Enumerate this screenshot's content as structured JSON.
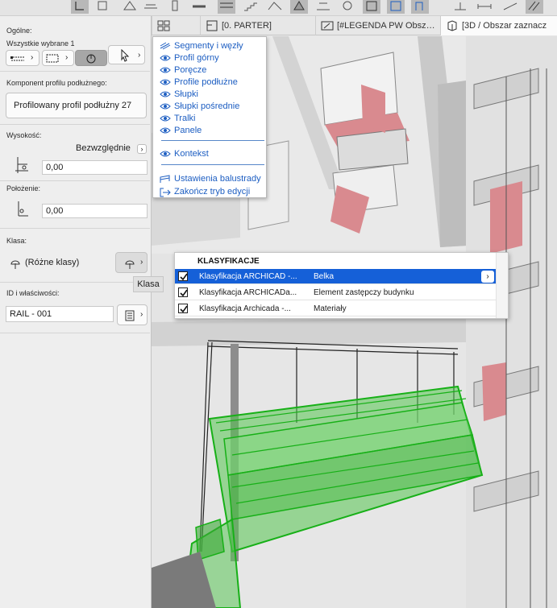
{
  "tabs": [
    {
      "label": "[0. PARTER]",
      "icon": "floor-plan-icon",
      "active": false
    },
    {
      "label": "[#LEGENDA PW Obsz…",
      "icon": "layout-icon",
      "active": false
    },
    {
      "label": "[3D / Obszar zaznacz",
      "icon": "cube-3d-icon",
      "active": true
    }
  ],
  "panel": {
    "general_label": "Ogólne:",
    "selection_label": "Wszystkie wybrane 1",
    "profile_label": "Komponent profilu podłużnego:",
    "profile_value": "Profilowany profil podłużny 27",
    "height_label": "Wysokość:",
    "height_mode": "Bezwzględnie",
    "height_value": "0,00",
    "position_label": "Położenie:",
    "position_value": "0,00",
    "class_label": "Klasa:",
    "class_value": "(Różne klasy)",
    "id_label": "ID i właściwości:",
    "id_value": "RAIL - 001"
  },
  "tooltip": "Klasa",
  "menu": {
    "items": [
      {
        "label": "Segmenty i węzły",
        "icon": "segments-icon"
      },
      {
        "label": "Profil górny",
        "icon": "eye-icon"
      },
      {
        "label": "Poręcze",
        "icon": "eye-icon"
      },
      {
        "label": "Profile podłużne",
        "icon": "eye-icon"
      },
      {
        "label": "Słupki",
        "icon": "eye-icon"
      },
      {
        "label": "Słupki pośrednie",
        "icon": "eye-icon"
      },
      {
        "label": "Tralki",
        "icon": "eye-icon"
      },
      {
        "label": "Panele",
        "icon": "eye-icon"
      },
      {
        "label": "Kontekst",
        "icon": "eye-icon"
      },
      {
        "label": "Ustawienia balustrady",
        "icon": "railing-settings-icon"
      },
      {
        "label": "Zakończ tryb edycji",
        "icon": "exit-edit-icon"
      }
    ]
  },
  "classification": {
    "title": "KLASYFIKACJE",
    "rows": [
      {
        "system": "Klasyfikacja ARCHICAD -...",
        "value": "Belka",
        "checked": true,
        "selected": true
      },
      {
        "system": "Klasyfikacja ARCHICADa...",
        "value": "Element zastępczy budynku",
        "checked": true,
        "selected": false
      },
      {
        "system": "Klasyfikacja Archicada -...",
        "value": "Materiały",
        "checked": true,
        "selected": false
      }
    ]
  },
  "colors": {
    "accent": "#1560d8",
    "link": "#1d5ec2",
    "selection_green": "#22b41e",
    "roof_red": "#d98a8f"
  }
}
